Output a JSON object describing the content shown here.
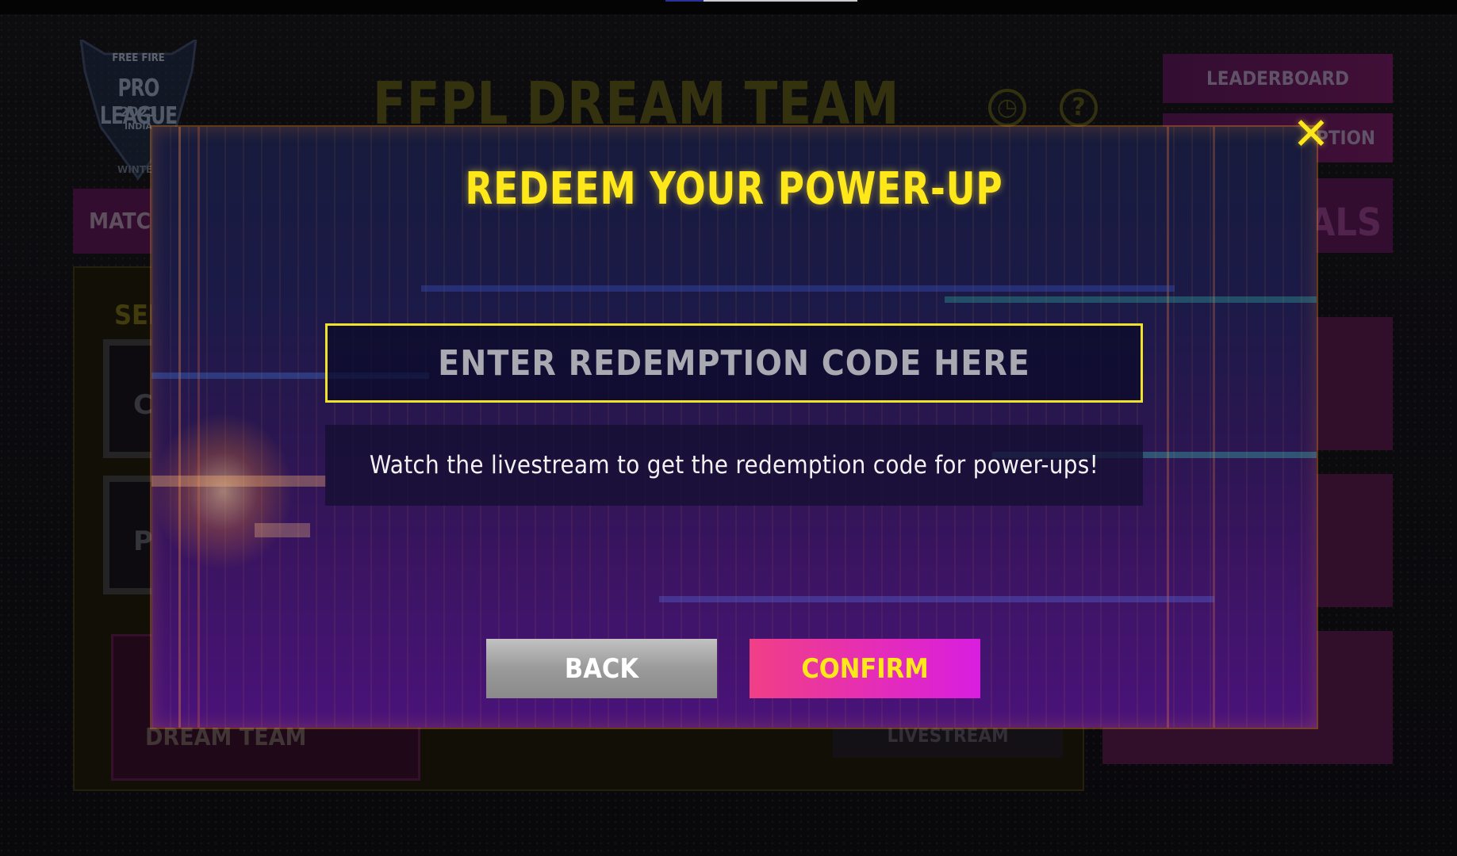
{
  "background": {
    "logo": {
      "line1": "FREE FIRE",
      "line2": "PRO LEAGUE",
      "line3": "2021",
      "line4": "INDIA",
      "line5": "WINTE"
    },
    "title": "FFPL DREAM TEAM",
    "leaderboard_label": "LEADERBOARD",
    "redemption_label": "PTION",
    "match_tab_label": "MATCH",
    "finals_label": "NALS",
    "select_label": "SEL",
    "card_letters": [
      "C",
      "P"
    ],
    "dream_team_label": "DREAM TEAM",
    "livestream_label": "LIVESTREAM",
    "clock_icon": "clock-icon",
    "help_icon": "help-icon"
  },
  "modal": {
    "title": "REDEEM YOUR POWER-UP",
    "code_input": {
      "placeholder": "ENTER REDEMPTION CODE HERE",
      "value": ""
    },
    "hint": "Watch the livestream to get the redemption code for power-ups!",
    "back_label": "BACK",
    "confirm_label": "CONFIRM",
    "close_icon": "close-icon"
  },
  "colors": {
    "accent_yellow": "#ffe81a",
    "confirm_gradient_start": "#f13f86",
    "confirm_gradient_end": "#d91ee0",
    "back_gray": "#9a9a9a"
  }
}
